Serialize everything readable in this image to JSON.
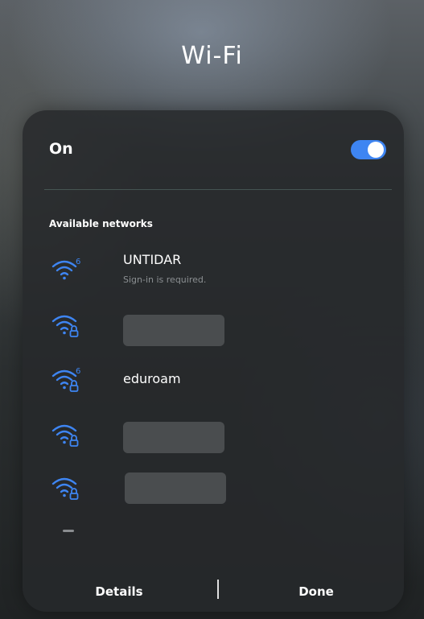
{
  "screen": {
    "title": "Wi-Fi"
  },
  "wifi_toggle": {
    "label": "On",
    "enabled": true,
    "accent_color": "#3e85f2"
  },
  "available_networks": {
    "header": "Available networks",
    "items": [
      {
        "name": "UNTIDAR",
        "subtitle": "Sign-in is required.",
        "secured": false,
        "wifi6": true,
        "icon": "wifi-6-icon"
      },
      {
        "name": "",
        "redacted": true,
        "secured": true,
        "wifi6": false,
        "icon": "wifi-lock-icon"
      },
      {
        "name": "eduroam",
        "secured": true,
        "wifi6": true,
        "icon": "wifi-6-lock-icon"
      },
      {
        "name": "",
        "redacted": true,
        "secured": true,
        "wifi6": false,
        "icon": "wifi-lock-icon"
      },
      {
        "name": "",
        "redacted": true,
        "secured": true,
        "wifi6": false,
        "icon": "wifi-lock-icon"
      }
    ]
  },
  "footer": {
    "details_label": "Details",
    "done_label": "Done"
  },
  "colors": {
    "icon_blue": "#3e85f2",
    "panel_bg": "#26292b"
  }
}
